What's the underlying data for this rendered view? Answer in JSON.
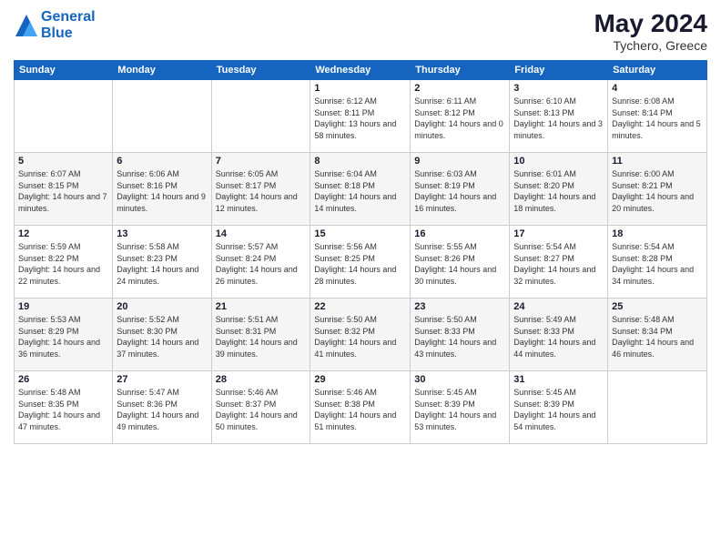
{
  "logo": {
    "line1": "General",
    "line2": "Blue"
  },
  "title": {
    "month_year": "May 2024",
    "location": "Tychero, Greece"
  },
  "days_of_week": [
    "Sunday",
    "Monday",
    "Tuesday",
    "Wednesday",
    "Thursday",
    "Friday",
    "Saturday"
  ],
  "weeks": [
    [
      {
        "day": "",
        "sunrise": "",
        "sunset": "",
        "daylight": ""
      },
      {
        "day": "",
        "sunrise": "",
        "sunset": "",
        "daylight": ""
      },
      {
        "day": "",
        "sunrise": "",
        "sunset": "",
        "daylight": ""
      },
      {
        "day": "1",
        "sunrise": "Sunrise: 6:12 AM",
        "sunset": "Sunset: 8:11 PM",
        "daylight": "Daylight: 13 hours and 58 minutes."
      },
      {
        "day": "2",
        "sunrise": "Sunrise: 6:11 AM",
        "sunset": "Sunset: 8:12 PM",
        "daylight": "Daylight: 14 hours and 0 minutes."
      },
      {
        "day": "3",
        "sunrise": "Sunrise: 6:10 AM",
        "sunset": "Sunset: 8:13 PM",
        "daylight": "Daylight: 14 hours and 3 minutes."
      },
      {
        "day": "4",
        "sunrise": "Sunrise: 6:08 AM",
        "sunset": "Sunset: 8:14 PM",
        "daylight": "Daylight: 14 hours and 5 minutes."
      }
    ],
    [
      {
        "day": "5",
        "sunrise": "Sunrise: 6:07 AM",
        "sunset": "Sunset: 8:15 PM",
        "daylight": "Daylight: 14 hours and 7 minutes."
      },
      {
        "day": "6",
        "sunrise": "Sunrise: 6:06 AM",
        "sunset": "Sunset: 8:16 PM",
        "daylight": "Daylight: 14 hours and 9 minutes."
      },
      {
        "day": "7",
        "sunrise": "Sunrise: 6:05 AM",
        "sunset": "Sunset: 8:17 PM",
        "daylight": "Daylight: 14 hours and 12 minutes."
      },
      {
        "day": "8",
        "sunrise": "Sunrise: 6:04 AM",
        "sunset": "Sunset: 8:18 PM",
        "daylight": "Daylight: 14 hours and 14 minutes."
      },
      {
        "day": "9",
        "sunrise": "Sunrise: 6:03 AM",
        "sunset": "Sunset: 8:19 PM",
        "daylight": "Daylight: 14 hours and 16 minutes."
      },
      {
        "day": "10",
        "sunrise": "Sunrise: 6:01 AM",
        "sunset": "Sunset: 8:20 PM",
        "daylight": "Daylight: 14 hours and 18 minutes."
      },
      {
        "day": "11",
        "sunrise": "Sunrise: 6:00 AM",
        "sunset": "Sunset: 8:21 PM",
        "daylight": "Daylight: 14 hours and 20 minutes."
      }
    ],
    [
      {
        "day": "12",
        "sunrise": "Sunrise: 5:59 AM",
        "sunset": "Sunset: 8:22 PM",
        "daylight": "Daylight: 14 hours and 22 minutes."
      },
      {
        "day": "13",
        "sunrise": "Sunrise: 5:58 AM",
        "sunset": "Sunset: 8:23 PM",
        "daylight": "Daylight: 14 hours and 24 minutes."
      },
      {
        "day": "14",
        "sunrise": "Sunrise: 5:57 AM",
        "sunset": "Sunset: 8:24 PM",
        "daylight": "Daylight: 14 hours and 26 minutes."
      },
      {
        "day": "15",
        "sunrise": "Sunrise: 5:56 AM",
        "sunset": "Sunset: 8:25 PM",
        "daylight": "Daylight: 14 hours and 28 minutes."
      },
      {
        "day": "16",
        "sunrise": "Sunrise: 5:55 AM",
        "sunset": "Sunset: 8:26 PM",
        "daylight": "Daylight: 14 hours and 30 minutes."
      },
      {
        "day": "17",
        "sunrise": "Sunrise: 5:54 AM",
        "sunset": "Sunset: 8:27 PM",
        "daylight": "Daylight: 14 hours and 32 minutes."
      },
      {
        "day": "18",
        "sunrise": "Sunrise: 5:54 AM",
        "sunset": "Sunset: 8:28 PM",
        "daylight": "Daylight: 14 hours and 34 minutes."
      }
    ],
    [
      {
        "day": "19",
        "sunrise": "Sunrise: 5:53 AM",
        "sunset": "Sunset: 8:29 PM",
        "daylight": "Daylight: 14 hours and 36 minutes."
      },
      {
        "day": "20",
        "sunrise": "Sunrise: 5:52 AM",
        "sunset": "Sunset: 8:30 PM",
        "daylight": "Daylight: 14 hours and 37 minutes."
      },
      {
        "day": "21",
        "sunrise": "Sunrise: 5:51 AM",
        "sunset": "Sunset: 8:31 PM",
        "daylight": "Daylight: 14 hours and 39 minutes."
      },
      {
        "day": "22",
        "sunrise": "Sunrise: 5:50 AM",
        "sunset": "Sunset: 8:32 PM",
        "daylight": "Daylight: 14 hours and 41 minutes."
      },
      {
        "day": "23",
        "sunrise": "Sunrise: 5:50 AM",
        "sunset": "Sunset: 8:33 PM",
        "daylight": "Daylight: 14 hours and 43 minutes."
      },
      {
        "day": "24",
        "sunrise": "Sunrise: 5:49 AM",
        "sunset": "Sunset: 8:33 PM",
        "daylight": "Daylight: 14 hours and 44 minutes."
      },
      {
        "day": "25",
        "sunrise": "Sunrise: 5:48 AM",
        "sunset": "Sunset: 8:34 PM",
        "daylight": "Daylight: 14 hours and 46 minutes."
      }
    ],
    [
      {
        "day": "26",
        "sunrise": "Sunrise: 5:48 AM",
        "sunset": "Sunset: 8:35 PM",
        "daylight": "Daylight: 14 hours and 47 minutes."
      },
      {
        "day": "27",
        "sunrise": "Sunrise: 5:47 AM",
        "sunset": "Sunset: 8:36 PM",
        "daylight": "Daylight: 14 hours and 49 minutes."
      },
      {
        "day": "28",
        "sunrise": "Sunrise: 5:46 AM",
        "sunset": "Sunset: 8:37 PM",
        "daylight": "Daylight: 14 hours and 50 minutes."
      },
      {
        "day": "29",
        "sunrise": "Sunrise: 5:46 AM",
        "sunset": "Sunset: 8:38 PM",
        "daylight": "Daylight: 14 hours and 51 minutes."
      },
      {
        "day": "30",
        "sunrise": "Sunrise: 5:45 AM",
        "sunset": "Sunset: 8:39 PM",
        "daylight": "Daylight: 14 hours and 53 minutes."
      },
      {
        "day": "31",
        "sunrise": "Sunrise: 5:45 AM",
        "sunset": "Sunset: 8:39 PM",
        "daylight": "Daylight: 14 hours and 54 minutes."
      },
      {
        "day": "",
        "sunrise": "",
        "sunset": "",
        "daylight": ""
      }
    ]
  ]
}
